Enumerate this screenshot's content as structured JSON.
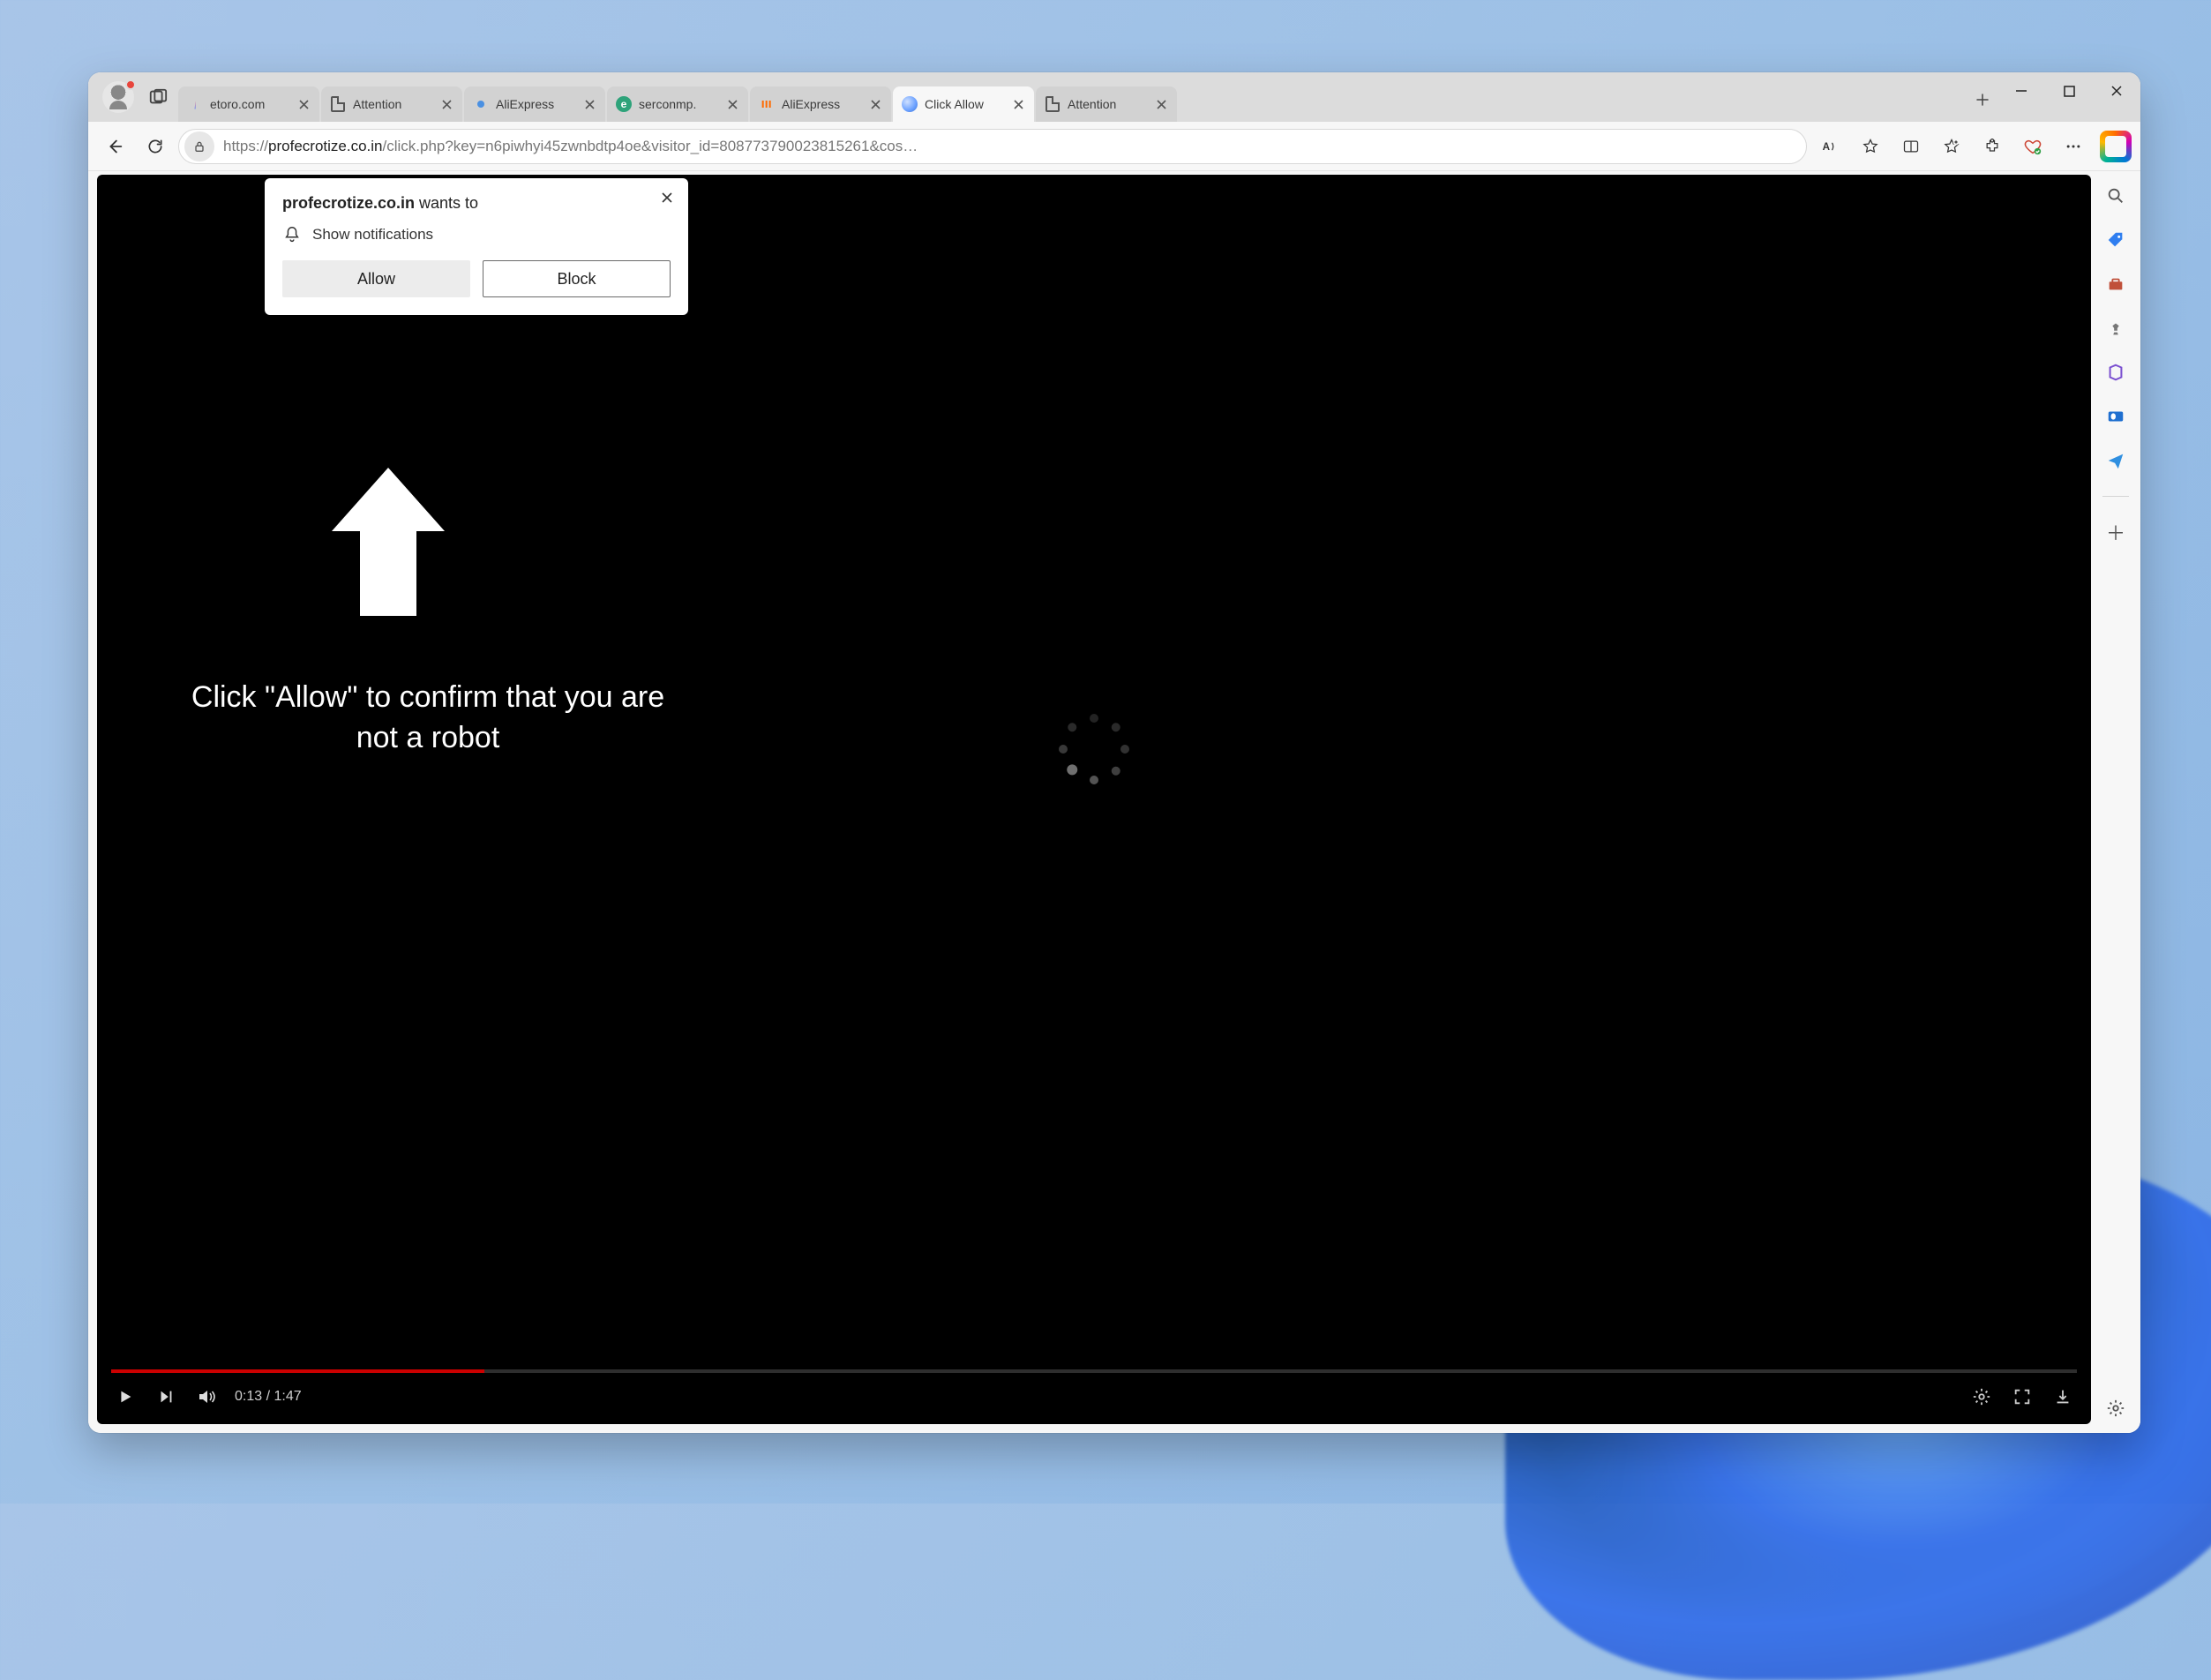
{
  "window": {
    "profile_status": "busy"
  },
  "tabs": [
    {
      "label": "etoro.com",
      "favicon": "etoro",
      "active": false
    },
    {
      "label": "Attention",
      "favicon": "page",
      "active": false
    },
    {
      "label": "AliExpress",
      "favicon": "dot",
      "active": false
    },
    {
      "label": "serconmp.",
      "favicon": "eround",
      "active": false
    },
    {
      "label": "AliExpress",
      "favicon": "ali",
      "active": false
    },
    {
      "label": "Click Allow",
      "favicon": "blob",
      "active": true
    },
    {
      "label": "Attention",
      "favicon": "page",
      "active": false
    }
  ],
  "addressbar": {
    "scheme": "https://",
    "host": "profecrotize.co.in",
    "path": "/click.php?key=n6piwhyi45zwnbdtp4oe&visitor_id=808773790023815261&cos…"
  },
  "toolbar_icons": [
    "read-aloud",
    "favorite",
    "immersive-reader",
    "collections",
    "extensions",
    "browser-essentials",
    "more"
  ],
  "sidebar_icons": [
    "search",
    "shopping-tag",
    "tools",
    "games",
    "microsoft-365",
    "outlook",
    "send"
  ],
  "page": {
    "instruction": "Click \"Allow\" to confirm that you are not a robot"
  },
  "video": {
    "current": "0:13",
    "duration": "1:47",
    "progress_percent": 19
  },
  "permission": {
    "origin": "profecrotize.co.in",
    "suffix": " wants to",
    "capability": "Show notifications",
    "allow": "Allow",
    "block": "Block"
  }
}
